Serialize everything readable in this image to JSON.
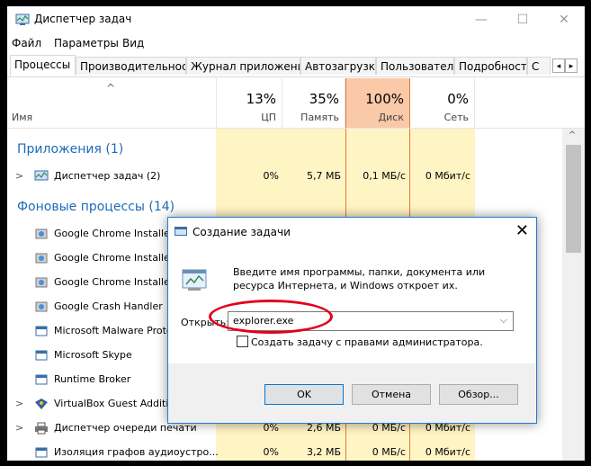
{
  "window": {
    "title": "Диспетчер задач",
    "minimize": "—",
    "maximize": "☐",
    "close": "✕"
  },
  "menu": [
    "Файл",
    "Параметры",
    "Вид"
  ],
  "tabs": [
    "Процессы",
    "Производительность",
    "Журнал приложений",
    "Автозагрузка",
    "Пользователи",
    "Подробности",
    "С"
  ],
  "header": {
    "name": "Имя",
    "cpu": {
      "pct": "13%",
      "label": "ЦП"
    },
    "mem": {
      "pct": "35%",
      "label": "Память"
    },
    "disk": {
      "pct": "100%",
      "label": "Диск"
    },
    "net": {
      "pct": "0%",
      "label": "Сеть"
    }
  },
  "groups": {
    "apps": "Приложения (1)",
    "background": "Фоновые процессы (14)"
  },
  "rows": [
    {
      "name": "Диспетчер задач (2)",
      "cpu": "0%",
      "mem": "5,7 МБ",
      "disk": "0,1 МБ/с",
      "net": "0 Мбит/с"
    },
    {
      "name": "Google Chrome Installer"
    },
    {
      "name": "Google Chrome Installer"
    },
    {
      "name": "Google Chrome Installer"
    },
    {
      "name": "Google Crash Handler"
    },
    {
      "name": "Microsoft Malware Prote"
    },
    {
      "name": "Microsoft Skype"
    },
    {
      "name": "Runtime Broker"
    },
    {
      "name": "VirtualBox Guest Additio"
    },
    {
      "name": "Диспетчер очереди печати",
      "cpu": "0%",
      "mem": "2,6 МБ",
      "disk": "0 МБ/с",
      "net": "0 Мбит/с"
    },
    {
      "name": "Изоляция графов аудиоустро...",
      "cpu": "0%",
      "mem": "3,2 МБ",
      "disk": "0 МБ/с",
      "net": "0 Мбит/с"
    }
  ],
  "dialog": {
    "title": "Создание задачи",
    "close": "✕",
    "description": "Введите имя программы, папки, документа или ресурса Интернета, и Windows откроет их.",
    "open_label": "Открыть:",
    "open_value": "explorer.exe",
    "admin_label": "Создать задачу с правами администратора.",
    "ok": "OK",
    "cancel": "Отмена",
    "browse": "Обзор..."
  },
  "colors": {
    "accent": "#1e6bb8",
    "disk_highlight": "#f9c9a8",
    "annotation": "#e3001b"
  }
}
